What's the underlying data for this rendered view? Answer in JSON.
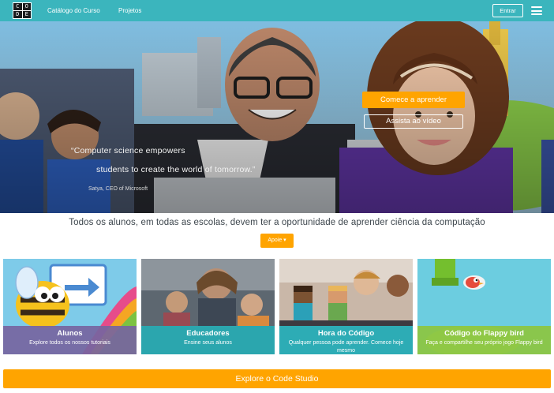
{
  "header": {
    "logo_letters": [
      "C",
      "O",
      "D",
      "E"
    ],
    "nav": [
      "Catálogo do Curso",
      "Projetos"
    ],
    "signin_label": "Entrar",
    "menu_icon": "hamburger-menu-icon"
  },
  "hero": {
    "start_button": "Comece a aprender",
    "video_button": "Assista ao vídeo",
    "quote_line1": "“Computer science empowers",
    "quote_line2": "students to create the world of tomorrow.”",
    "quote_author": "Satya, CEO of Microsoft"
  },
  "tagline": "Todos os alunos, em todas as escolas, devem ter a oportunidade de aprender ciência da computação",
  "support_button": "Apoie ▾",
  "tiles": [
    {
      "title": "Alunos",
      "subtitle": "Explore todos os nossos tutoriais"
    },
    {
      "title": "Educadores",
      "subtitle": "Ensine seus alunos"
    },
    {
      "title": "Hora do Código",
      "subtitle": "Qualquer pessoa pode aprender. Comece hoje mesmo"
    },
    {
      "title": "Código do Flappy bird",
      "subtitle": "Faça e compartilhe seu próprio jogo Flappy bird"
    }
  ],
  "explore_button": "Explore o Code Studio",
  "colors": {
    "header": "#3bb5bd",
    "accent_orange": "#ffa400",
    "tile_caption_purple": "#7665a0",
    "tile_caption_teal": "#2bb6bf",
    "tile_caption_green": "#8dc63f"
  }
}
